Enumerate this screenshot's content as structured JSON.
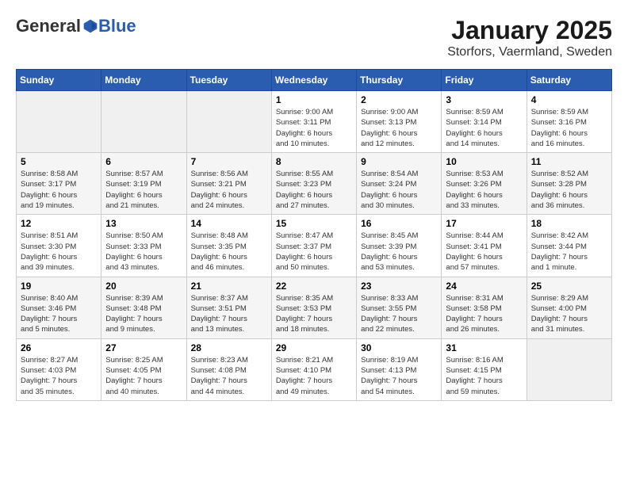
{
  "header": {
    "logo_general": "General",
    "logo_blue": "Blue",
    "title": "January 2025",
    "subtitle": "Storfors, Vaermland, Sweden"
  },
  "weekdays": [
    "Sunday",
    "Monday",
    "Tuesday",
    "Wednesday",
    "Thursday",
    "Friday",
    "Saturday"
  ],
  "weeks": [
    [
      {
        "day": "",
        "info": ""
      },
      {
        "day": "",
        "info": ""
      },
      {
        "day": "",
        "info": ""
      },
      {
        "day": "1",
        "info": "Sunrise: 9:00 AM\nSunset: 3:11 PM\nDaylight: 6 hours\nand 10 minutes."
      },
      {
        "day": "2",
        "info": "Sunrise: 9:00 AM\nSunset: 3:13 PM\nDaylight: 6 hours\nand 12 minutes."
      },
      {
        "day": "3",
        "info": "Sunrise: 8:59 AM\nSunset: 3:14 PM\nDaylight: 6 hours\nand 14 minutes."
      },
      {
        "day": "4",
        "info": "Sunrise: 8:59 AM\nSunset: 3:16 PM\nDaylight: 6 hours\nand 16 minutes."
      }
    ],
    [
      {
        "day": "5",
        "info": "Sunrise: 8:58 AM\nSunset: 3:17 PM\nDaylight: 6 hours\nand 19 minutes."
      },
      {
        "day": "6",
        "info": "Sunrise: 8:57 AM\nSunset: 3:19 PM\nDaylight: 6 hours\nand 21 minutes."
      },
      {
        "day": "7",
        "info": "Sunrise: 8:56 AM\nSunset: 3:21 PM\nDaylight: 6 hours\nand 24 minutes."
      },
      {
        "day": "8",
        "info": "Sunrise: 8:55 AM\nSunset: 3:23 PM\nDaylight: 6 hours\nand 27 minutes."
      },
      {
        "day": "9",
        "info": "Sunrise: 8:54 AM\nSunset: 3:24 PM\nDaylight: 6 hours\nand 30 minutes."
      },
      {
        "day": "10",
        "info": "Sunrise: 8:53 AM\nSunset: 3:26 PM\nDaylight: 6 hours\nand 33 minutes."
      },
      {
        "day": "11",
        "info": "Sunrise: 8:52 AM\nSunset: 3:28 PM\nDaylight: 6 hours\nand 36 minutes."
      }
    ],
    [
      {
        "day": "12",
        "info": "Sunrise: 8:51 AM\nSunset: 3:30 PM\nDaylight: 6 hours\nand 39 minutes."
      },
      {
        "day": "13",
        "info": "Sunrise: 8:50 AM\nSunset: 3:33 PM\nDaylight: 6 hours\nand 43 minutes."
      },
      {
        "day": "14",
        "info": "Sunrise: 8:48 AM\nSunset: 3:35 PM\nDaylight: 6 hours\nand 46 minutes."
      },
      {
        "day": "15",
        "info": "Sunrise: 8:47 AM\nSunset: 3:37 PM\nDaylight: 6 hours\nand 50 minutes."
      },
      {
        "day": "16",
        "info": "Sunrise: 8:45 AM\nSunset: 3:39 PM\nDaylight: 6 hours\nand 53 minutes."
      },
      {
        "day": "17",
        "info": "Sunrise: 8:44 AM\nSunset: 3:41 PM\nDaylight: 6 hours\nand 57 minutes."
      },
      {
        "day": "18",
        "info": "Sunrise: 8:42 AM\nSunset: 3:44 PM\nDaylight: 7 hours\nand 1 minute."
      }
    ],
    [
      {
        "day": "19",
        "info": "Sunrise: 8:40 AM\nSunset: 3:46 PM\nDaylight: 7 hours\nand 5 minutes."
      },
      {
        "day": "20",
        "info": "Sunrise: 8:39 AM\nSunset: 3:48 PM\nDaylight: 7 hours\nand 9 minutes."
      },
      {
        "day": "21",
        "info": "Sunrise: 8:37 AM\nSunset: 3:51 PM\nDaylight: 7 hours\nand 13 minutes."
      },
      {
        "day": "22",
        "info": "Sunrise: 8:35 AM\nSunset: 3:53 PM\nDaylight: 7 hours\nand 18 minutes."
      },
      {
        "day": "23",
        "info": "Sunrise: 8:33 AM\nSunset: 3:55 PM\nDaylight: 7 hours\nand 22 minutes."
      },
      {
        "day": "24",
        "info": "Sunrise: 8:31 AM\nSunset: 3:58 PM\nDaylight: 7 hours\nand 26 minutes."
      },
      {
        "day": "25",
        "info": "Sunrise: 8:29 AM\nSunset: 4:00 PM\nDaylight: 7 hours\nand 31 minutes."
      }
    ],
    [
      {
        "day": "26",
        "info": "Sunrise: 8:27 AM\nSunset: 4:03 PM\nDaylight: 7 hours\nand 35 minutes."
      },
      {
        "day": "27",
        "info": "Sunrise: 8:25 AM\nSunset: 4:05 PM\nDaylight: 7 hours\nand 40 minutes."
      },
      {
        "day": "28",
        "info": "Sunrise: 8:23 AM\nSunset: 4:08 PM\nDaylight: 7 hours\nand 44 minutes."
      },
      {
        "day": "29",
        "info": "Sunrise: 8:21 AM\nSunset: 4:10 PM\nDaylight: 7 hours\nand 49 minutes."
      },
      {
        "day": "30",
        "info": "Sunrise: 8:19 AM\nSunset: 4:13 PM\nDaylight: 7 hours\nand 54 minutes."
      },
      {
        "day": "31",
        "info": "Sunrise: 8:16 AM\nSunset: 4:15 PM\nDaylight: 7 hours\nand 59 minutes."
      },
      {
        "day": "",
        "info": ""
      }
    ]
  ]
}
